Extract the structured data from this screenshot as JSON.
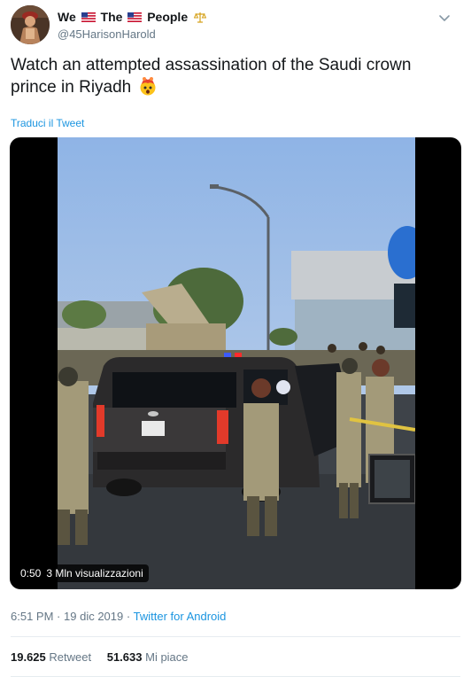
{
  "user": {
    "name_first": "We",
    "name_middle": "The",
    "name_last": "People",
    "handle": "@45HarisonHarold"
  },
  "tweet": {
    "text": "Watch an attempted assassination of the Saudi crown prince in Riyadh",
    "emoji": "exploding-head",
    "translate_label": "Traduci il Tweet"
  },
  "video": {
    "duration": "0:50",
    "views": "3 Mln visualizzazioni"
  },
  "meta": {
    "time": "6:51 PM",
    "date": "19 dic 2019",
    "source": "Twitter for Android",
    "separator": "·"
  },
  "stats": {
    "retweets_count": "19.625",
    "retweets_label": "Retweet",
    "likes_count": "51.633",
    "likes_label": "Mi piace"
  },
  "colors": {
    "link": "#1b95e0",
    "secondary": "#657786",
    "text": "#14171a"
  }
}
